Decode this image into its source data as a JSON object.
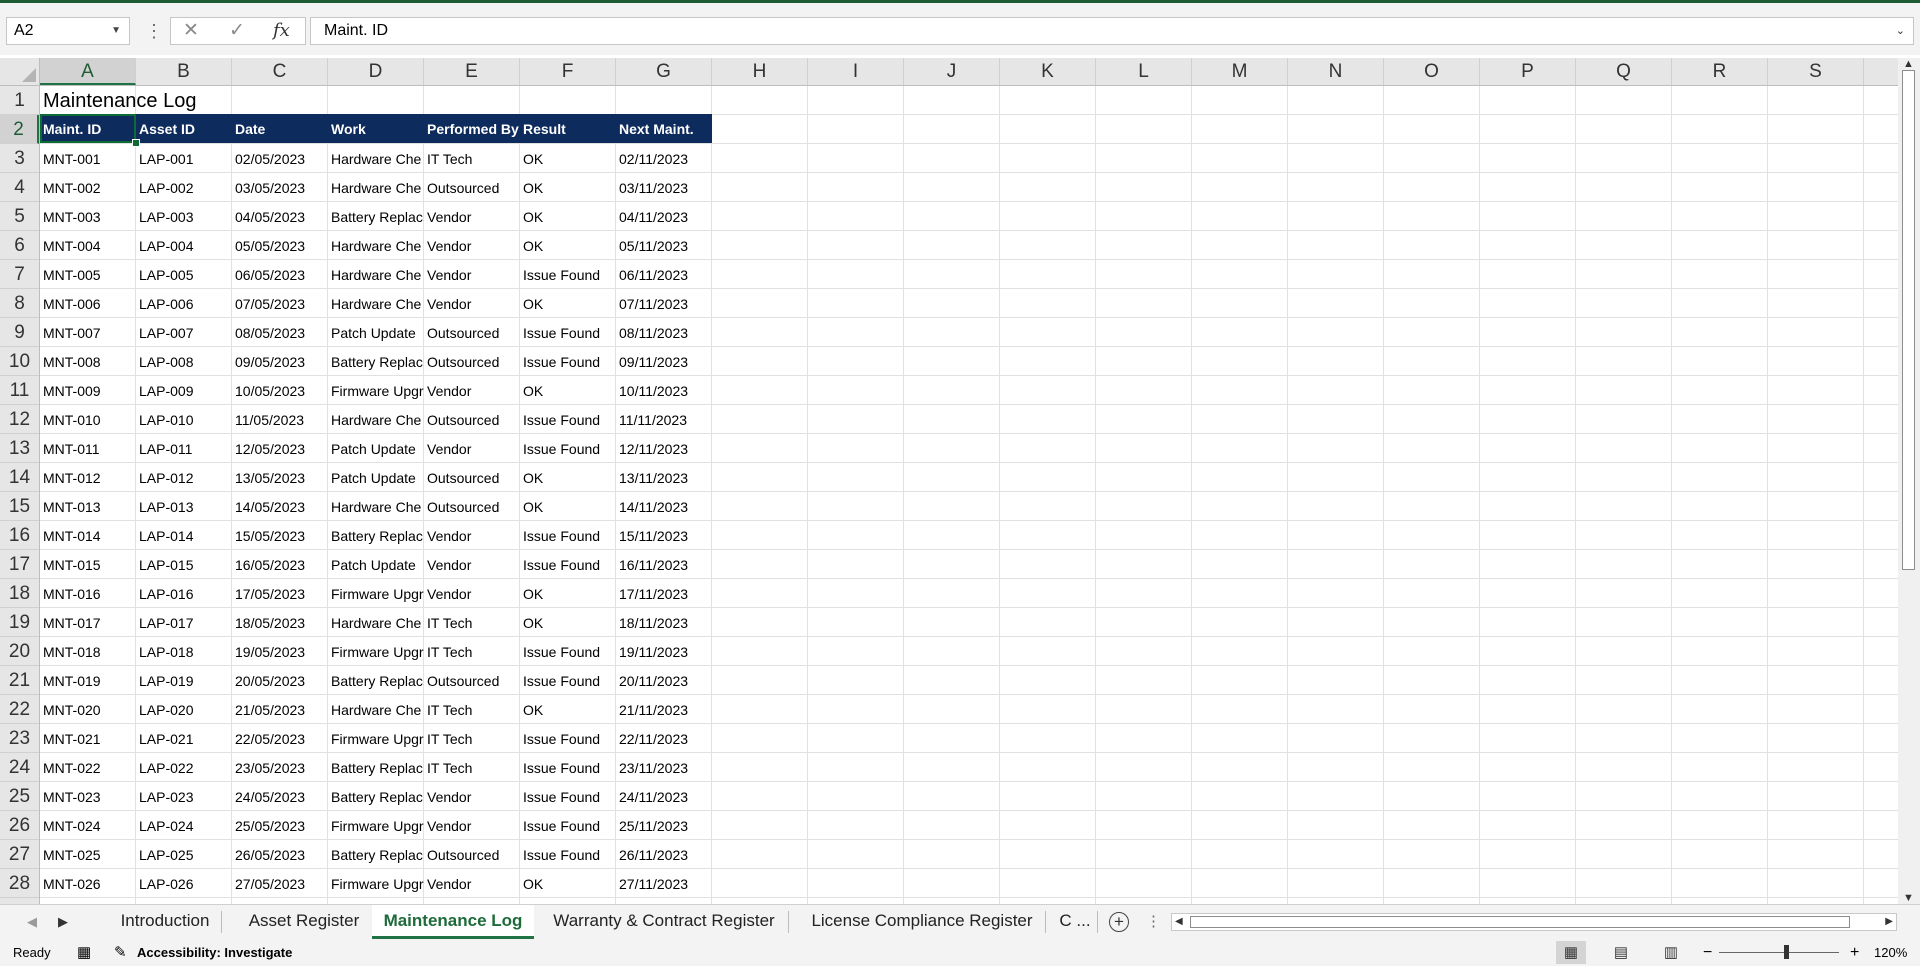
{
  "name_box": "A2",
  "formula_bar": {
    "value": "Maint. ID",
    "cancel_icon": "✕",
    "enter_icon": "✓",
    "fx_label": "fx"
  },
  "columns": [
    "A",
    "B",
    "C",
    "D",
    "E",
    "F",
    "G",
    "H",
    "I",
    "J",
    "K",
    "L",
    "M",
    "N",
    "O",
    "P",
    "Q",
    "R",
    "S"
  ],
  "row_numbers": [
    "1",
    "2",
    "3",
    "4",
    "5",
    "6",
    "7",
    "8",
    "9",
    "10",
    "11",
    "12",
    "13",
    "14",
    "15",
    "16",
    "17",
    "18",
    "19",
    "20",
    "21",
    "22",
    "23",
    "24",
    "25",
    "26",
    "27",
    "28"
  ],
  "sheet": {
    "title": "Maintenance Log",
    "headers": [
      "Maint. ID",
      "Asset ID",
      "Date",
      "Work",
      "Performed By",
      "Result",
      "Next Maint."
    ],
    "rows": [
      [
        "MNT-001",
        "LAP-001",
        "02/05/2023",
        "Hardware Che",
        "IT Tech",
        "OK",
        "02/11/2023"
      ],
      [
        "MNT-002",
        "LAP-002",
        "03/05/2023",
        "Hardware Che",
        "Outsourced",
        "OK",
        "03/11/2023"
      ],
      [
        "MNT-003",
        "LAP-003",
        "04/05/2023",
        "Battery Replac",
        "Vendor",
        "OK",
        "04/11/2023"
      ],
      [
        "MNT-004",
        "LAP-004",
        "05/05/2023",
        "Hardware Che",
        "Vendor",
        "OK",
        "05/11/2023"
      ],
      [
        "MNT-005",
        "LAP-005",
        "06/05/2023",
        "Hardware Che",
        "Vendor",
        "Issue Found",
        "06/11/2023"
      ],
      [
        "MNT-006",
        "LAP-006",
        "07/05/2023",
        "Hardware Che",
        "Vendor",
        "OK",
        "07/11/2023"
      ],
      [
        "MNT-007",
        "LAP-007",
        "08/05/2023",
        "Patch Update",
        "Outsourced",
        "Issue Found",
        "08/11/2023"
      ],
      [
        "MNT-008",
        "LAP-008",
        "09/05/2023",
        "Battery Replac",
        "Outsourced",
        "Issue Found",
        "09/11/2023"
      ],
      [
        "MNT-009",
        "LAP-009",
        "10/05/2023",
        "Firmware Upgr",
        "Vendor",
        "OK",
        "10/11/2023"
      ],
      [
        "MNT-010",
        "LAP-010",
        "11/05/2023",
        "Hardware Che",
        "Outsourced",
        "Issue Found",
        "11/11/2023"
      ],
      [
        "MNT-011",
        "LAP-011",
        "12/05/2023",
        "Patch Update",
        "Vendor",
        "Issue Found",
        "12/11/2023"
      ],
      [
        "MNT-012",
        "LAP-012",
        "13/05/2023",
        "Patch Update",
        "Outsourced",
        "OK",
        "13/11/2023"
      ],
      [
        "MNT-013",
        "LAP-013",
        "14/05/2023",
        "Hardware Che",
        "Outsourced",
        "OK",
        "14/11/2023"
      ],
      [
        "MNT-014",
        "LAP-014",
        "15/05/2023",
        "Battery Replac",
        "Vendor",
        "Issue Found",
        "15/11/2023"
      ],
      [
        "MNT-015",
        "LAP-015",
        "16/05/2023",
        "Patch Update",
        "Vendor",
        "Issue Found",
        "16/11/2023"
      ],
      [
        "MNT-016",
        "LAP-016",
        "17/05/2023",
        "Firmware Upgr",
        "Vendor",
        "OK",
        "17/11/2023"
      ],
      [
        "MNT-017",
        "LAP-017",
        "18/05/2023",
        "Hardware Che",
        "IT Tech",
        "OK",
        "18/11/2023"
      ],
      [
        "MNT-018",
        "LAP-018",
        "19/05/2023",
        "Firmware Upgr",
        "IT Tech",
        "Issue Found",
        "19/11/2023"
      ],
      [
        "MNT-019",
        "LAP-019",
        "20/05/2023",
        "Battery Replac",
        "Outsourced",
        "Issue Found",
        "20/11/2023"
      ],
      [
        "MNT-020",
        "LAP-020",
        "21/05/2023",
        "Hardware Che",
        "IT Tech",
        "OK",
        "21/11/2023"
      ],
      [
        "MNT-021",
        "LAP-021",
        "22/05/2023",
        "Firmware Upgr",
        "IT Tech",
        "Issue Found",
        "22/11/2023"
      ],
      [
        "MNT-022",
        "LAP-022",
        "23/05/2023",
        "Battery Replac",
        "IT Tech",
        "Issue Found",
        "23/11/2023"
      ],
      [
        "MNT-023",
        "LAP-023",
        "24/05/2023",
        "Battery Replac",
        "Vendor",
        "Issue Found",
        "24/11/2023"
      ],
      [
        "MNT-024",
        "LAP-024",
        "25/05/2023",
        "Firmware Upgr",
        "Vendor",
        "Issue Found",
        "25/11/2023"
      ],
      [
        "MNT-025",
        "LAP-025",
        "26/05/2023",
        "Battery Replac",
        "Outsourced",
        "Issue Found",
        "26/11/2023"
      ],
      [
        "MNT-026",
        "LAP-026",
        "27/05/2023",
        "Firmware Upgr",
        "Vendor",
        "OK",
        "27/11/2023"
      ]
    ]
  },
  "tabs": [
    {
      "label": "Introduction",
      "active": false
    },
    {
      "label": "Asset Register",
      "active": false
    },
    {
      "label": "Maintenance Log",
      "active": true
    },
    {
      "label": "Warranty & Contract Register",
      "active": false
    },
    {
      "label": "License Compliance Register",
      "active": false
    },
    {
      "label": "C ...",
      "active": false
    }
  ],
  "status": {
    "ready": "Ready",
    "accessibility": "Accessibility: Investigate",
    "zoom": "120%"
  },
  "colors": {
    "accent": "#217346",
    "header_fill": "#0d2b5c",
    "header_text": "#ffffff"
  }
}
